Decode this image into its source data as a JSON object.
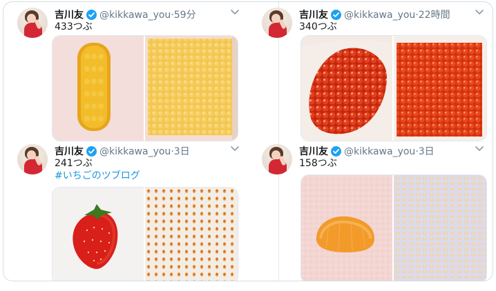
{
  "tweets": [
    {
      "name": "吉川友",
      "handle": "@kikkawa_you",
      "separator": "·",
      "time": "59分",
      "text": "433つぶ",
      "hashtag": ""
    },
    {
      "name": "吉川友",
      "handle": "@kikkawa_you",
      "separator": "·",
      "time": "22時間",
      "text": "340つぶ",
      "hashtag": ""
    },
    {
      "name": "吉川友",
      "handle": "@kikkawa_you",
      "separator": "·",
      "time": "3日",
      "text": "241つぶ",
      "hashtag": "#いちごのツブログ"
    },
    {
      "name": "吉川友",
      "handle": "@kikkawa_you",
      "separator": "·",
      "time": "3日",
      "text": "158つぶ",
      "hashtag": ""
    }
  ],
  "icons": {
    "verified": "verified-badge-icon",
    "caret": "chevron-down-icon"
  },
  "colors": {
    "accent": "#1da1f2",
    "link": "#1b95e0",
    "muted": "#657786",
    "border": "#e1e8ed"
  }
}
